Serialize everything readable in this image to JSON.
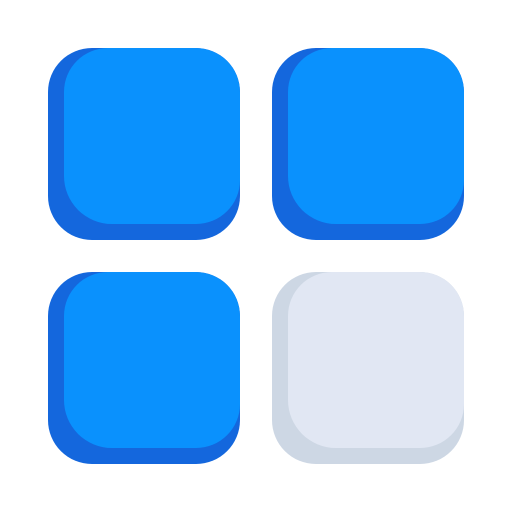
{
  "icon": {
    "name": "grid-apps-icon",
    "tiles": [
      {
        "name": "tile-top-left",
        "state": "active",
        "face_color": "#0a91fd",
        "shade_color": "#1467dd"
      },
      {
        "name": "tile-top-right",
        "state": "active",
        "face_color": "#0a91fd",
        "shade_color": "#1467dd"
      },
      {
        "name": "tile-bottom-left",
        "state": "active",
        "face_color": "#0a91fd",
        "shade_color": "#1467dd"
      },
      {
        "name": "tile-bottom-right",
        "state": "inactive",
        "face_color": "#e1e7f3",
        "shade_color": "#cdd7e4"
      }
    ]
  }
}
